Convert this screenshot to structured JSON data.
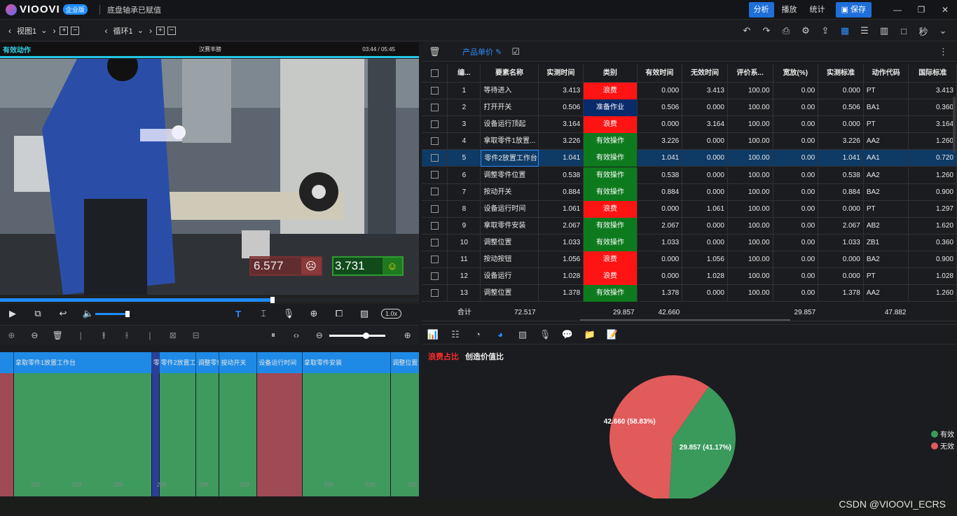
{
  "title_bar": {
    "app_name": "VIOOVI",
    "edition_badge": "企业版",
    "document_title": "底盘轴承已赋值",
    "buttons": [
      "分析",
      "播放",
      "统计"
    ],
    "save_label": "保存",
    "window_controls": [
      "—",
      "❐",
      "✕"
    ]
  },
  "toolbar": {
    "view_label": "视图1",
    "loop_label": "循环1",
    "unit_label": "秒"
  },
  "video": {
    "mode_label": "有效动作",
    "center_label": "汉赛丰膀",
    "time_display": "03:44 / 05:45",
    "invalid_score": "6.577",
    "valid_score": "3.731",
    "speed": "1.0x",
    "progress": 0.65,
    "volume": 0.9
  },
  "timeline": {
    "segments": [
      {
        "label": "拿取零件1放置工作台",
        "kind": "valid",
        "start": 0.0,
        "end": 3.226
      },
      {
        "label": "零件2放置工作台",
        "kind": "selected",
        "start": 3.226,
        "end": 3.4
      },
      {
        "label": "零件2放置工作台",
        "kind": "valid",
        "start": 3.4,
        "end": 4.267
      },
      {
        "label": "调整零件位置",
        "kind": "valid",
        "start": 4.267,
        "end": 4.805
      },
      {
        "label": "按动开关",
        "kind": "valid",
        "start": 4.805,
        "end": 5.689
      },
      {
        "label": "设备运行时间",
        "kind": "invalid",
        "start": 5.689,
        "end": 6.75
      },
      {
        "label": "拿取零件安装",
        "kind": "valid",
        "start": 6.75,
        "end": 8.817
      },
      {
        "label": "调整位置",
        "kind": "valid",
        "start": 8.817,
        "end": 9.6
      }
    ],
    "ticks": [
      "222",
      "223",
      "224",
      "226",
      "226",
      "227",
      "229",
      "230",
      "231"
    ]
  },
  "table": {
    "columns": [
      "编...",
      "要素名称",
      "实测时间",
      "类别",
      "有效时间",
      "无效时间",
      "评价系...",
      "宽放(%)",
      "实测标准",
      "动作代码",
      "国际标准"
    ],
    "rows": [
      {
        "no": "1",
        "name": "等待进入",
        "measured": "3.413",
        "category": "浪费",
        "cat": "red",
        "valid": "0.000",
        "invalid": "3.413",
        "rating": "100.00",
        "allowance": "0.00",
        "standard": "0.000",
        "code": "PT",
        "intl": "3.413"
      },
      {
        "no": "2",
        "name": "打开开关",
        "measured": "0.506",
        "category": "准备作业",
        "cat": "navy",
        "valid": "0.506",
        "invalid": "0.000",
        "rating": "100.00",
        "allowance": "0.00",
        "standard": "0.506",
        "code": "BA1",
        "intl": "0.360"
      },
      {
        "no": "3",
        "name": "设备运行顶起",
        "measured": "3.164",
        "category": "浪费",
        "cat": "red",
        "valid": "0.000",
        "invalid": "3.164",
        "rating": "100.00",
        "allowance": "0.00",
        "standard": "0.000",
        "code": "PT",
        "intl": "3.164"
      },
      {
        "no": "4",
        "name": "拿取零件1放置...",
        "measured": "3.226",
        "category": "有效操作",
        "cat": "green",
        "valid": "3.226",
        "invalid": "0.000",
        "rating": "100.00",
        "allowance": "0.00",
        "standard": "3.226",
        "code": "AA2",
        "intl": "1.260"
      },
      {
        "no": "5",
        "name": "零件2放置工作台",
        "measured": "1.041",
        "category": "有效操作",
        "cat": "green",
        "valid": "1.041",
        "invalid": "0.000",
        "rating": "100.00",
        "allowance": "0.00",
        "standard": "1.041",
        "code": "AA1",
        "intl": "0.720"
      },
      {
        "no": "6",
        "name": "调整零件位置",
        "measured": "0.538",
        "category": "有效操作",
        "cat": "green",
        "valid": "0.538",
        "invalid": "0.000",
        "rating": "100.00",
        "allowance": "0.00",
        "standard": "0.538",
        "code": "AA2",
        "intl": "1.260"
      },
      {
        "no": "7",
        "name": "按动开关",
        "measured": "0.884",
        "category": "有效操作",
        "cat": "green",
        "valid": "0.884",
        "invalid": "0.000",
        "rating": "100.00",
        "allowance": "0.00",
        "standard": "0.884",
        "code": "BA2",
        "intl": "0.900"
      },
      {
        "no": "8",
        "name": "设备运行时间",
        "measured": "1.061",
        "category": "浪费",
        "cat": "red",
        "valid": "0.000",
        "invalid": "1.061",
        "rating": "100.00",
        "allowance": "0.00",
        "standard": "0.000",
        "code": "PT",
        "intl": "1.297"
      },
      {
        "no": "9",
        "name": "拿取零件安装",
        "measured": "2.067",
        "category": "有效操作",
        "cat": "green",
        "valid": "2.067",
        "invalid": "0.000",
        "rating": "100.00",
        "allowance": "0.00",
        "standard": "2.067",
        "code": "AB2",
        "intl": "1.620"
      },
      {
        "no": "10",
        "name": "调整位置",
        "measured": "1.033",
        "category": "有效操作",
        "cat": "green",
        "valid": "1.033",
        "invalid": "0.000",
        "rating": "100.00",
        "allowance": "0.00",
        "standard": "1.033",
        "code": "ZB1",
        "intl": "0.360"
      },
      {
        "no": "11",
        "name": "按动按钮",
        "measured": "1.056",
        "category": "浪费",
        "cat": "red",
        "valid": "0.000",
        "invalid": "1.056",
        "rating": "100.00",
        "allowance": "0.00",
        "standard": "0.000",
        "code": "BA2",
        "intl": "0.900"
      },
      {
        "no": "12",
        "name": "设备运行",
        "measured": "1.028",
        "category": "浪费",
        "cat": "red",
        "valid": "0.000",
        "invalid": "1.028",
        "rating": "100.00",
        "allowance": "0.00",
        "standard": "0.000",
        "code": "PT",
        "intl": "1.028"
      },
      {
        "no": "13",
        "name": "调整位置",
        "measured": "1.378",
        "category": "有效操作",
        "cat": "green",
        "valid": "1.378",
        "invalid": "0.000",
        "rating": "100.00",
        "allowance": "0.00",
        "standard": "1.378",
        "code": "AA2",
        "intl": "1.260"
      }
    ],
    "selected_row": 4,
    "summary": {
      "label": "合计",
      "measured": "72.517",
      "valid": "29.857",
      "invalid": "42.660",
      "standard": "29.857",
      "intl": "47.882"
    },
    "toolbar_link": "产品单价"
  },
  "chart_panel": {
    "tabs": [
      "浪费占比",
      "创造价值比"
    ],
    "active_tab": 0,
    "watermark": "CSDN @VIOOVI_ECRS"
  },
  "chart_data": {
    "type": "pie",
    "categories": [
      "有效",
      "无效"
    ],
    "values": [
      29.857,
      42.66
    ],
    "labels": [
      "29.857 (41.17%)",
      "42.660 (58.83%)"
    ],
    "colors": [
      "#3a9a5c",
      "#e15b5b"
    ],
    "legend": "right"
  }
}
